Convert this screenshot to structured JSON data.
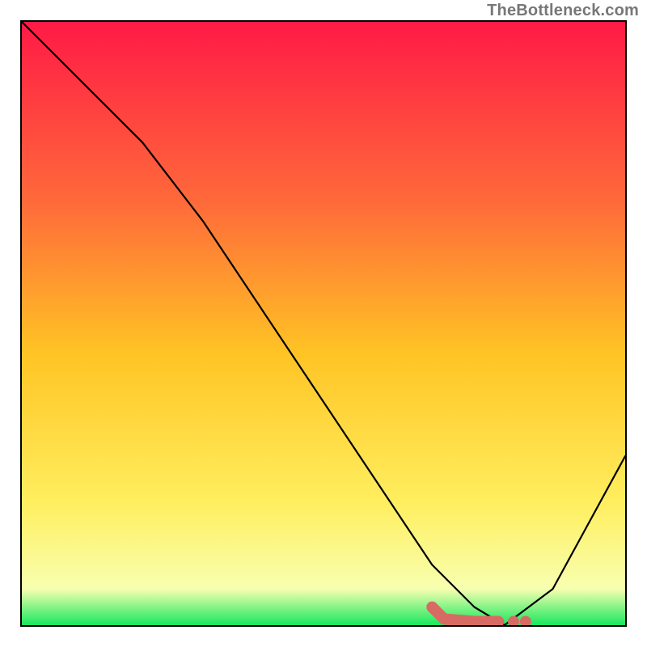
{
  "attribution": "TheBottleneck.com",
  "chart_data": {
    "type": "line",
    "title": "",
    "xlabel": "",
    "ylabel": "",
    "xlim": [
      0,
      100
    ],
    "ylim": [
      0,
      100
    ],
    "grid": false,
    "background": {
      "type": "vertical-gradient",
      "stops": [
        {
          "pos": 0.0,
          "color": "#ff1a46"
        },
        {
          "pos": 0.3,
          "color": "#ff6a3a"
        },
        {
          "pos": 0.55,
          "color": "#ffc424"
        },
        {
          "pos": 0.8,
          "color": "#ffef60"
        },
        {
          "pos": 0.94,
          "color": "#f7ffb0"
        },
        {
          "pos": 1.0,
          "color": "#17e85e"
        }
      ]
    },
    "series": [
      {
        "name": "bottleneck-curve",
        "color": "#000000",
        "x": [
          0,
          10,
          20,
          30,
          40,
          50,
          60,
          68,
          75,
          80,
          88,
          100
        ],
        "y": [
          100,
          90,
          80,
          67,
          52,
          37,
          22,
          10,
          3,
          0,
          6,
          28
        ]
      }
    ],
    "marker": {
      "name": "optimal-zone",
      "color": "#d86a64",
      "stroke_width": 14,
      "points_x": [
        68,
        70,
        75,
        77,
        79
      ],
      "points_y": [
        3,
        1,
        0.6,
        0.6,
        0.6
      ],
      "dots": [
        {
          "x": 81.5,
          "y": 0.6
        },
        {
          "x": 83.5,
          "y": 0.6
        }
      ]
    }
  }
}
